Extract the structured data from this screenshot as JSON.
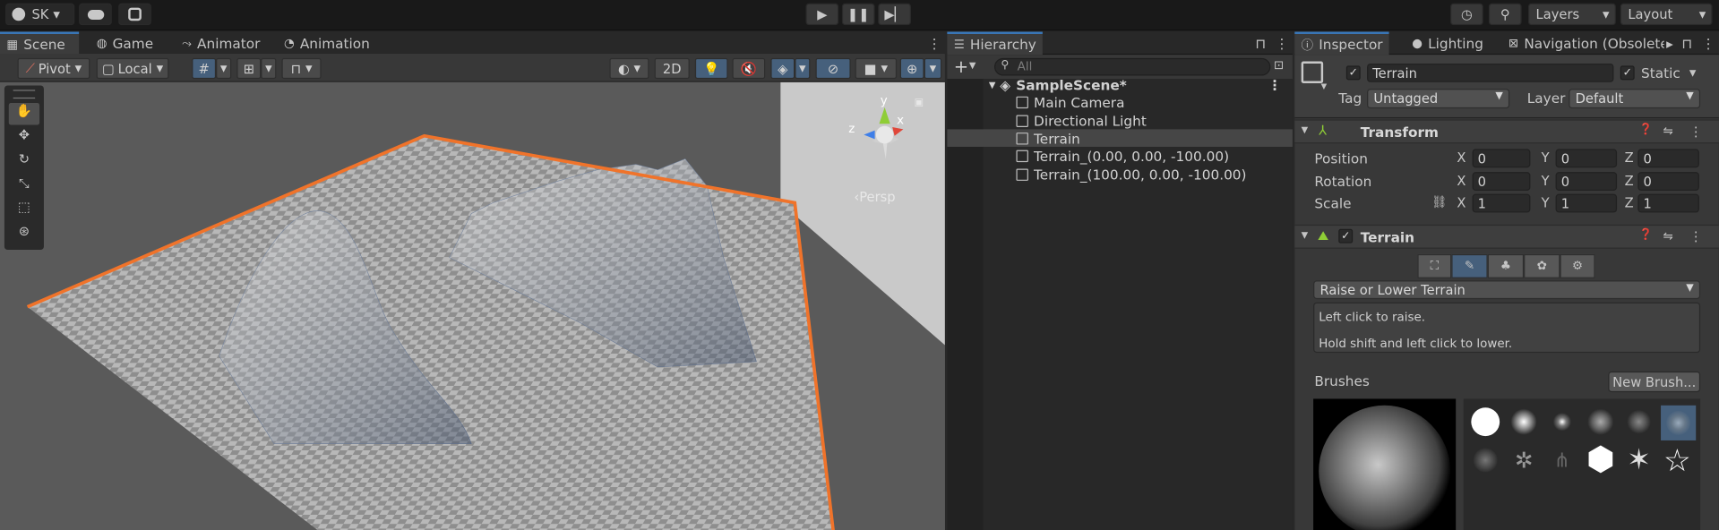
{
  "account": {
    "label": "SK"
  },
  "top_right": {
    "layers": "Layers",
    "layout": "Layout"
  },
  "scene_tabs": [
    {
      "label": "Scene",
      "icon": "grid-icon"
    },
    {
      "label": "Game",
      "icon": "gamepad-icon"
    },
    {
      "label": "Animator",
      "icon": "animator-icon"
    },
    {
      "label": "Animation",
      "icon": "clock-icon"
    }
  ],
  "scene_toolbar": {
    "pivot": "Pivot",
    "local": "Local",
    "mode2d": "2D"
  },
  "gizmo": {
    "x": "x",
    "y": "y",
    "z": "z",
    "persp": "‹Persp"
  },
  "colors": {
    "accent": "#3a79bb",
    "selection_outline": "#f0732a",
    "gizmo_x": "#e0473a",
    "gizmo_y": "#8fcd36",
    "gizmo_z": "#3f7fe8"
  },
  "hierarchy": {
    "tab": "Hierarchy",
    "search_placeholder": "All",
    "scene_name": "SampleScene*",
    "items": [
      {
        "label": "Main Camera"
      },
      {
        "label": "Directional Light"
      },
      {
        "label": "Terrain",
        "selected": true
      },
      {
        "label": "Terrain_(0.00, 0.00, -100.00)"
      },
      {
        "label": "Terrain_(100.00, 0.00, -100.00)"
      }
    ]
  },
  "inspector": {
    "tabs": [
      {
        "label": "Inspector"
      },
      {
        "label": "Lighting"
      },
      {
        "label": "Navigation (Obsolete"
      }
    ],
    "object_name": "Terrain",
    "static_label": "Static",
    "tag_label": "Tag",
    "tag_value": "Untagged",
    "layer_label": "Layer",
    "layer_value": "Default",
    "transform": {
      "title": "Transform",
      "position": {
        "label": "Position",
        "x": "0",
        "y": "0",
        "z": "0"
      },
      "rotation": {
        "label": "Rotation",
        "x": "0",
        "y": "0",
        "z": "0"
      },
      "scale": {
        "label": "Scale",
        "x": "1",
        "y": "1",
        "z": "1"
      },
      "axes": {
        "x": "X",
        "y": "Y",
        "z": "Z"
      }
    },
    "terrain": {
      "title": "Terrain",
      "tool": "Raise or Lower Terrain",
      "help_line1": "Left click to raise.",
      "help_line2": "Hold shift and left click to lower.",
      "brushes_label": "Brushes",
      "new_brush": "New Brush..."
    }
  }
}
